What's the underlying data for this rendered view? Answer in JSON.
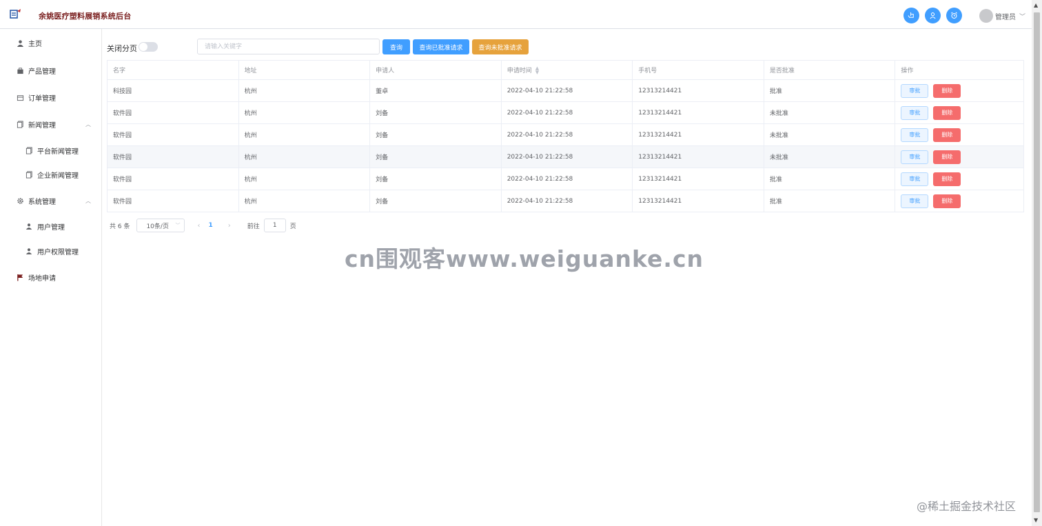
{
  "header": {
    "app_title": "余姚医疗塑料展销系统后台",
    "logo_icon": "logo-icon",
    "icons": [
      "hand-pointer-icon",
      "user-badge-icon",
      "alarm-icon"
    ],
    "user_name": "管理员",
    "accent": "#409eff"
  },
  "sidebar": {
    "items": [
      {
        "label": "主页",
        "icon": "user-icon"
      },
      {
        "label": "产品管理",
        "icon": "bag-icon"
      },
      {
        "label": "订单管理",
        "icon": "box-icon"
      },
      {
        "label": "新闻管理",
        "icon": "document-icon"
      },
      {
        "label": "平台新闻管理",
        "icon": "document-icon"
      },
      {
        "label": "企业新闻管理",
        "icon": "document-icon"
      },
      {
        "label": "系统管理",
        "icon": "gear-icon"
      },
      {
        "label": "用户管理",
        "icon": "user-icon"
      },
      {
        "label": "用户权限管理",
        "icon": "user-icon"
      },
      {
        "label": "场地申请",
        "icon": "flag-icon"
      }
    ]
  },
  "toolbar": {
    "toggle_label": "关闭分页",
    "search_placeholder": "请输入关键字",
    "query_label": "查询",
    "approved_label": "查询已批准请求",
    "unapproved_label": "查询未批准请求"
  },
  "table": {
    "headers": [
      "名字",
      "地址",
      "申请人",
      "申请时间",
      "手机号",
      "是否批准",
      "操作"
    ],
    "rows": [
      [
        "科技园",
        "杭州",
        "董卓",
        "2022-04-10 21:22:58",
        "12313214421",
        "批准"
      ],
      [
        "软件园",
        "杭州",
        "刘备",
        "2022-04-10 21:22:58",
        "12313214421",
        "未批准"
      ],
      [
        "软件园",
        "杭州",
        "刘备",
        "2022-04-10 21:22:58",
        "12313214421",
        "未批准"
      ],
      [
        "软件园",
        "杭州",
        "刘备",
        "2022-04-10 21:22:58",
        "12313214421",
        "未批准"
      ],
      [
        "软件园",
        "杭州",
        "刘备",
        "2022-04-10 21:22:58",
        "12313214421",
        "批准"
      ],
      [
        "软件园",
        "杭州",
        "刘备",
        "2022-04-10 21:22:58",
        "12313214421",
        "批准"
      ]
    ],
    "approve_label": "审批",
    "delete_label": "删除"
  },
  "pagination": {
    "total": "共 6 条",
    "page_size": "10条/页",
    "current_page": "1",
    "goto_label": "前往",
    "goto_value": "1",
    "page_suffix": "页"
  },
  "watermark": "cn围观客www.weiguanke.cn",
  "footer_mark": "@稀土掘金技术社区"
}
